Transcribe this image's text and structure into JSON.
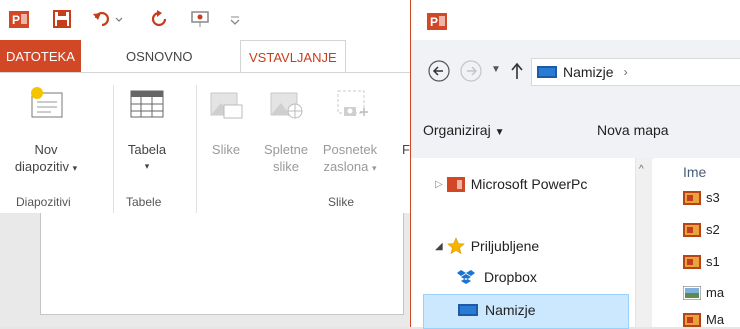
{
  "ppt": {
    "tabs": {
      "file": "DATOTEKA",
      "home": "OSNOVNO",
      "insert": "VSTAVLJANJE"
    },
    "ribbon": {
      "new_slide_line1": "Nov",
      "new_slide_line2": "diapozitiv",
      "table": "Tabela",
      "pictures": "Slike",
      "online_pictures_line1": "Spletne",
      "online_pictures_line2": "slike",
      "screenshot_line1": "Posnetek",
      "screenshot_line2": "zaslona",
      "cut_letter": "F",
      "groups": {
        "slides": "Diapozitivi",
        "tables": "Tabele",
        "images": "Slike"
      }
    }
  },
  "dialog": {
    "app_icon_label": "P",
    "address": {
      "location": "Namizje"
    },
    "toolbar": {
      "organize": "Organiziraj",
      "new_folder": "Nova mapa"
    },
    "nav": {
      "powerpoint": "Microsoft PowerPc",
      "favorites": "Priljubljene",
      "dropbox": "Dropbox",
      "desktop": "Namizje"
    },
    "files": {
      "column_name": "Ime",
      "items": [
        "s3",
        "s2",
        "s1",
        "ma",
        "Ma"
      ]
    }
  }
}
